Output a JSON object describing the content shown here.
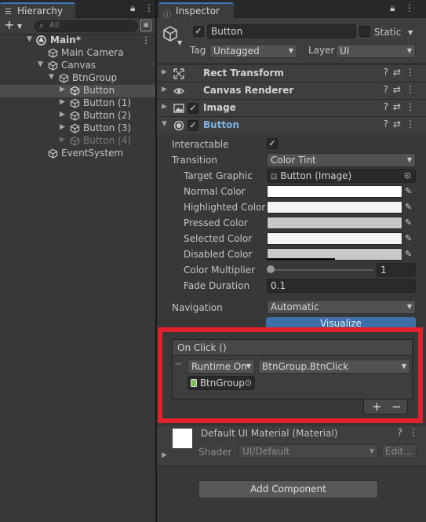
{
  "hierarchy": {
    "tab_label": "Hierarchy",
    "search_placeholder": "All",
    "rows": [
      {
        "label": "Main*",
        "kind": "scene",
        "indent": 0,
        "expanded": true
      },
      {
        "label": "Main Camera",
        "kind": "object",
        "indent": 1
      },
      {
        "label": "Canvas",
        "kind": "object",
        "indent": 1,
        "expanded": true
      },
      {
        "label": "BtnGroup",
        "kind": "object",
        "indent": 2,
        "expanded": true
      },
      {
        "label": "Button",
        "kind": "object",
        "indent": 3,
        "selected": true
      },
      {
        "label": "Button (1)",
        "kind": "object",
        "indent": 3
      },
      {
        "label": "Button (2)",
        "kind": "object",
        "indent": 3
      },
      {
        "label": "Button (3)",
        "kind": "object",
        "indent": 3
      },
      {
        "label": "Button (4)",
        "kind": "object",
        "indent": 3,
        "inactive": true
      },
      {
        "label": "EventSystem",
        "kind": "object",
        "indent": 1
      }
    ]
  },
  "inspector": {
    "tab_label": "Inspector",
    "object_name": "Button",
    "object_active": true,
    "static_label": "Static",
    "tag_label": "Tag",
    "tag_value": "Untagged",
    "layer_label": "Layer",
    "layer_value": "UI",
    "components": [
      {
        "title": "Rect Transform",
        "icon": "rect-transform-icon",
        "has_toggle": false
      },
      {
        "title": "Canvas Renderer",
        "icon": "eye-icon",
        "has_toggle": false
      },
      {
        "title": "Image",
        "icon": "image-icon",
        "has_toggle": true
      },
      {
        "title": "Button",
        "icon": "button-component-icon",
        "has_toggle": true
      }
    ],
    "button": {
      "interactable_label": "Interactable",
      "interactable": true,
      "transition_label": "Transition",
      "transition_value": "Color Tint",
      "target_graphic_label": "Target Graphic",
      "target_graphic_value": "Button (Image)",
      "colors": [
        {
          "label": "Normal Color",
          "hex": "#FFFFFF",
          "alpha": 1.0
        },
        {
          "label": "Highlighted Color",
          "hex": "#F5F5F5",
          "alpha": 1.0
        },
        {
          "label": "Pressed Color",
          "hex": "#C8C8C8",
          "alpha": 1.0
        },
        {
          "label": "Selected Color",
          "hex": "#F5F5F5",
          "alpha": 1.0
        },
        {
          "label": "Disabled Color",
          "hex": "#C8C8C8",
          "alpha": 0.5
        }
      ],
      "color_multiplier_label": "Color Multiplier",
      "color_multiplier": 1,
      "color_multiplier_text": "1",
      "fade_duration_label": "Fade Duration",
      "fade_duration": "0.1",
      "navigation_label": "Navigation",
      "navigation_value": "Automatic",
      "visualize_label": "Visualize",
      "onclick_title": "On Click ()",
      "onclick_entry": {
        "runtime": "Runtime On",
        "function": "BtnGroup.BtnClick",
        "target": "BtnGroup"
      },
      "add_label": "+",
      "remove_label": "−"
    },
    "material": {
      "name": "Default UI Material (Material)",
      "shader_label": "Shader",
      "shader_value": "UI/Default",
      "edit_label": "Edit..."
    },
    "add_component_label": "Add Component"
  },
  "colors": {
    "highlight_box": "#E3212B",
    "accent_blue": "#3F6FA8",
    "selected_row": "#4D4D4D"
  }
}
